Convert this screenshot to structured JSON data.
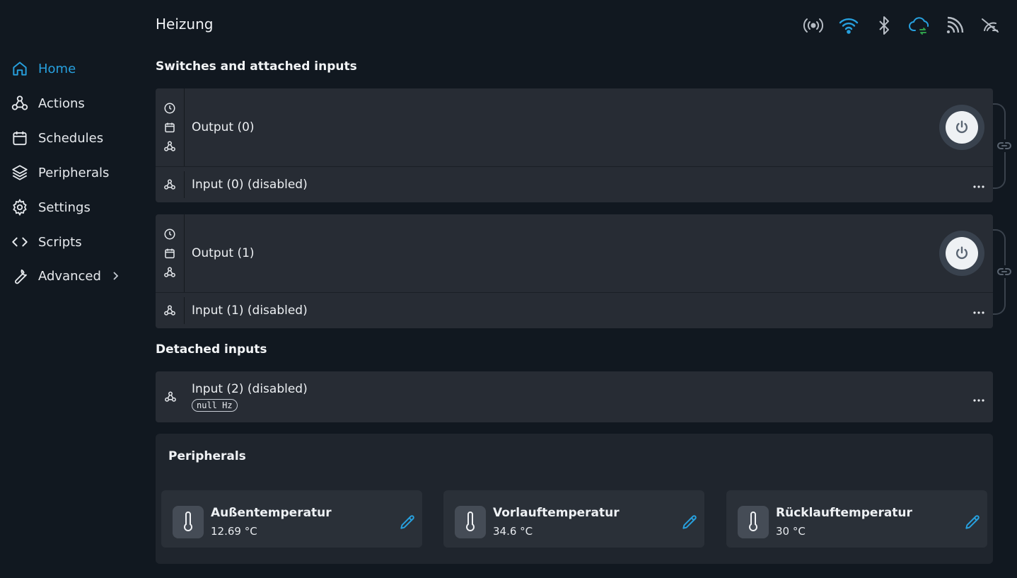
{
  "header": {
    "title": "Heizung"
  },
  "status_icons": [
    "broadcast-icon",
    "wifi-icon",
    "bluetooth-icon",
    "cloud-sync-icon",
    "rss-icon",
    "network-off-icon"
  ],
  "sidebar": {
    "items": [
      {
        "label": "Home",
        "icon": "home-icon",
        "active": true
      },
      {
        "label": "Actions",
        "icon": "webhook-icon"
      },
      {
        "label": "Schedules",
        "icon": "calendar-icon"
      },
      {
        "label": "Peripherals",
        "icon": "layers-icon"
      },
      {
        "label": "Settings",
        "icon": "gear-icon"
      },
      {
        "label": "Scripts",
        "icon": "code-icon"
      },
      {
        "label": "Advanced",
        "icon": "wrench-icon",
        "expandable": true
      }
    ]
  },
  "sections": {
    "switches_title": "Switches and attached inputs",
    "detached_title": "Detached inputs"
  },
  "switches": [
    {
      "output_label": "Output (0)",
      "input_label": "Input (0) (disabled)"
    },
    {
      "output_label": "Output (1)",
      "input_label": "Input (1) (disabled)"
    }
  ],
  "detached": [
    {
      "label": "Input (2) (disabled)",
      "badge": "null Hz"
    }
  ],
  "peripherals": {
    "title": "Peripherals",
    "sensors": [
      {
        "name": "Außentemperatur",
        "value": "12.69 °C"
      },
      {
        "name": "Vorlauftemperatur",
        "value": "34.6 °C"
      },
      {
        "name": "Rücklauftemperatur",
        "value": "30 °C"
      }
    ]
  },
  "colors": {
    "background": "#111820",
    "card": "#272c34",
    "accent": "#27a0de",
    "cloud_sync": "#2f9e4a"
  }
}
